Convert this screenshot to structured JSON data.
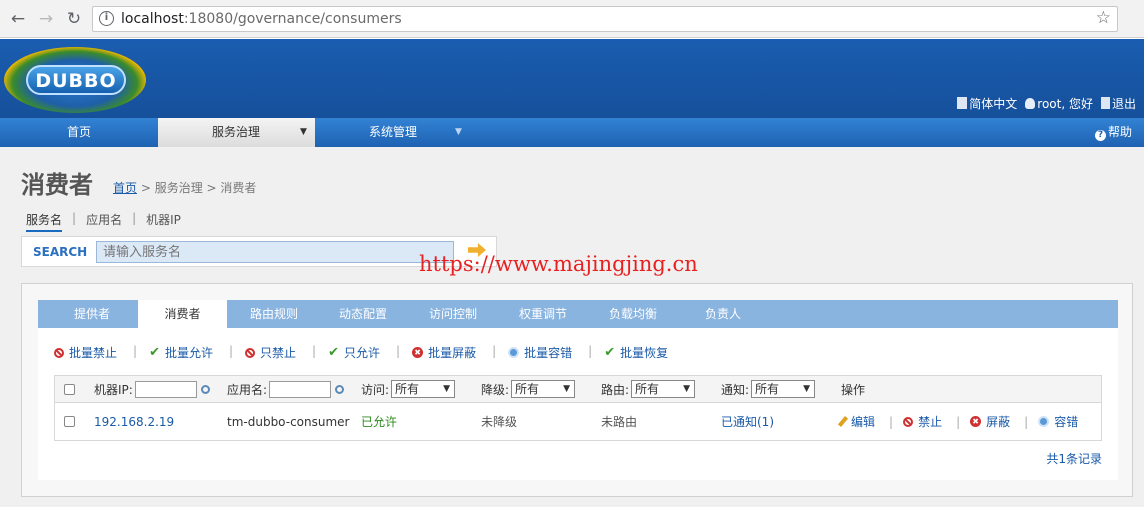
{
  "browser": {
    "url_host": "localhost",
    "url_rest": ":18080/governance/consumers"
  },
  "header": {
    "logo_text": "DUBBO",
    "links": [
      "简体中文",
      "root, 您好",
      "退出"
    ]
  },
  "mainnav": {
    "items": [
      "首页",
      "服务治理",
      "系统管理"
    ],
    "help": "帮助"
  },
  "page": {
    "title": "消费者",
    "breadcrumb": {
      "home": "首页",
      "rest": " > 服务治理 > 消费者"
    },
    "search_tabs": [
      "服务名",
      "应用名",
      "机器IP"
    ],
    "search_label": "SEARCH",
    "search_placeholder": "请输入服务名",
    "watermark": "https://www.majingjing.cn"
  },
  "panel": {
    "tabs": [
      "提供者",
      "消费者",
      "路由规则",
      "动态配置",
      "访问控制",
      "权重调节",
      "负载均衡",
      "负责人"
    ],
    "actions": [
      "批量禁止",
      "批量允许",
      "只禁止",
      "只允许",
      "批量屏蔽",
      "批量容错",
      "批量恢复"
    ],
    "filters": {
      "ip_label": "机器IP:",
      "app_label": "应用名:",
      "access_label": "访问:",
      "degrade_label": "降级:",
      "route_label": "路由:",
      "notify_label": "通知:",
      "select_value": "所有",
      "op_label": "操作"
    },
    "rows": [
      {
        "ip": "192.168.2.19",
        "app": "tm-dubbo-consumer",
        "access": "已允许",
        "degrade": "未降级",
        "route": "未路由",
        "notify": "已通知(1)",
        "ops": [
          "编辑",
          "禁止",
          "屏蔽",
          "容错"
        ]
      }
    ],
    "total": "共1条记录"
  },
  "colors": {
    "header": "#1a56a6",
    "accent": "#2a6fc0",
    "tab_bar": "#8ab4e0",
    "allowed_green": "#2e8a1e",
    "ban_red": "#d03030"
  }
}
